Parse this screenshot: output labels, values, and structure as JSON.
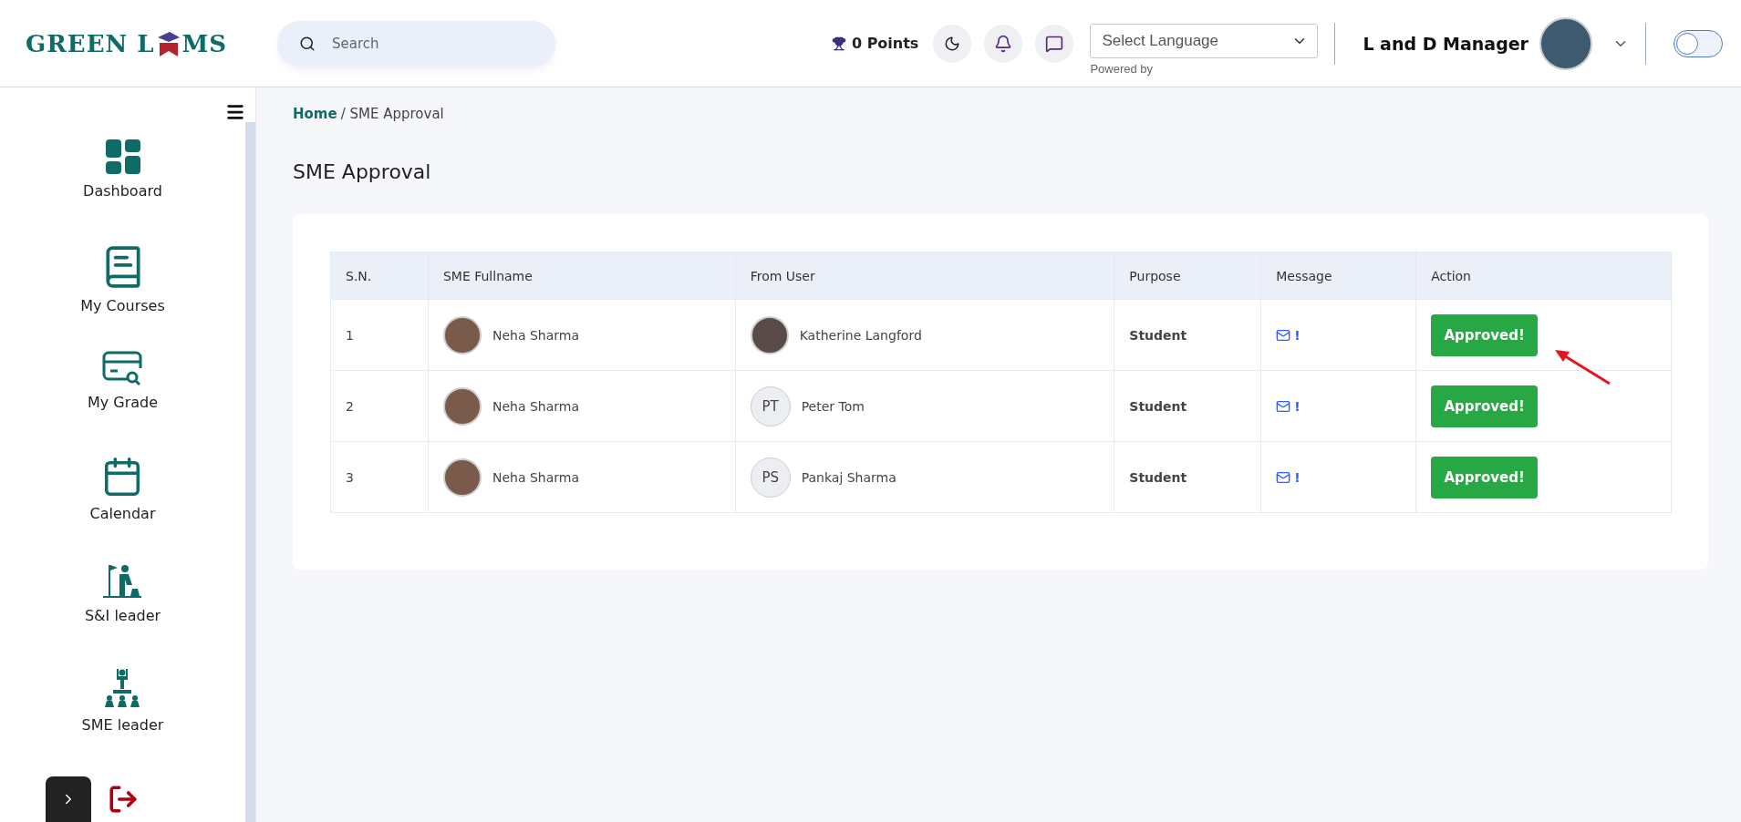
{
  "logo": {
    "text_left": "GREEN L",
    "text_right": "MS"
  },
  "search": {
    "placeholder": "Search"
  },
  "points": "0 Points",
  "language": {
    "value": "Select Language",
    "note": "Powered by"
  },
  "user": {
    "name": "L and D Manager"
  },
  "theme_toggle": {
    "on": false
  },
  "sidebar": {
    "items": [
      {
        "kind": "dashboard",
        "label": "Dashboard"
      },
      {
        "kind": "courses",
        "label": "My Courses"
      },
      {
        "kind": "grade",
        "label": "My Grade"
      },
      {
        "kind": "calendar",
        "label": "Calendar"
      },
      {
        "kind": "si",
        "label": "S&I leader"
      },
      {
        "kind": "sme",
        "label": "SME leader"
      }
    ]
  },
  "breadcrumb": {
    "home": "Home",
    "current": "/ SME Approval"
  },
  "page_title": "SME Approval",
  "table": {
    "columns": [
      "S.N.",
      "SME Fullname",
      "From User",
      "Purpose",
      "Message",
      "Action"
    ],
    "rows": [
      {
        "sn": "1",
        "sme": "Neha Sharma",
        "from": {
          "kind": "photo",
          "name": "Katherine Langford"
        },
        "purpose": "Student",
        "message": "!",
        "action": "Approved!",
        "pointed": true
      },
      {
        "sn": "2",
        "sme": "Neha Sharma",
        "from": {
          "kind": "initials",
          "initials": "PT",
          "name": "Peter Tom"
        },
        "purpose": "Student",
        "message": "!",
        "action": "Approved!",
        "pointed": false
      },
      {
        "sn": "3",
        "sme": "Neha Sharma",
        "from": {
          "kind": "initials",
          "initials": "PS",
          "name": "Pankaj Sharma"
        },
        "purpose": "Student",
        "message": "!",
        "action": "Approved!",
        "pointed": false
      }
    ]
  }
}
